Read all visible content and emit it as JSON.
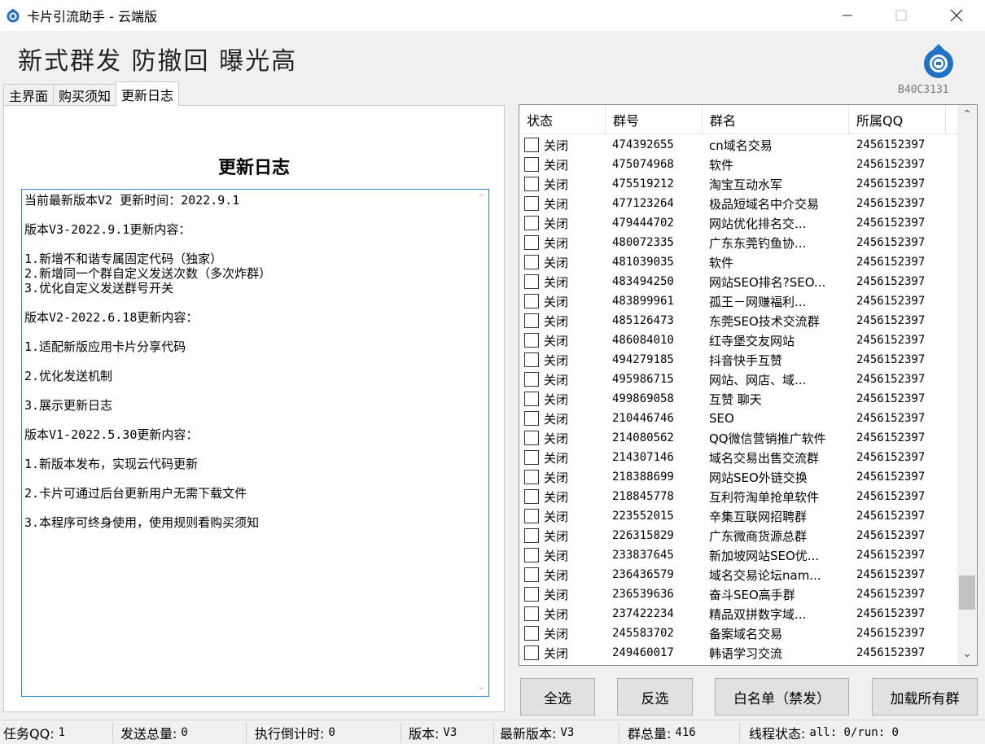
{
  "window": {
    "title": "卡片引流助手 - 云端版",
    "minimize_glyph": "—",
    "close_glyph": "✕",
    "icon": "app-logo-icon"
  },
  "header": {
    "slogan": "新式群发 防撤回 曝光高",
    "version_code": "B40C3131",
    "accent_color": "#1e73c8"
  },
  "tabs": [
    {
      "label": "主界面",
      "active": false
    },
    {
      "label": "购买须知",
      "active": false
    },
    {
      "label": "更新日志",
      "active": true
    }
  ],
  "changelog": {
    "title": "更新日志",
    "lines": [
      "当前最新版本V2 更新时间：2022.9.1",
      "",
      "版本V3-2022.9.1更新内容：",
      "",
      "1.新增不和谐专属固定代码（独家）",
      "2.新增同一个群自定义发送次数（多次炸群）",
      "3.优化自定义发送群号开关",
      "",
      "版本V2-2022.6.18更新内容：",
      "",
      "1.适配新版应用卡片分享代码",
      "",
      "2.优化发送机制",
      "",
      "3.展示更新日志",
      "",
      "版本V1-2022.5.30更新内容：",
      "",
      "1.新版本发布，实现云代码更新",
      "",
      "2.卡片可通过后台更新用户无需下载文件",
      "",
      "3.本程序可终身使用，使用规则看购买须知"
    ]
  },
  "group_list": {
    "columns": [
      "状态",
      "群号",
      "群名",
      "所属QQ"
    ],
    "rows": [
      {
        "status": "关闭",
        "id": "474392655",
        "name": "cn域名交易",
        "qq": "2456152397"
      },
      {
        "status": "关闭",
        "id": "475074968",
        "name": "软件",
        "qq": "2456152397"
      },
      {
        "status": "关闭",
        "id": "475519212",
        "name": "淘宝互动水军",
        "qq": "2456152397"
      },
      {
        "status": "关闭",
        "id": "477123264",
        "name": "极品短域名中介交易",
        "qq": "2456152397"
      },
      {
        "status": "关闭",
        "id": "479444702",
        "name": "网站优化排名交...",
        "qq": "2456152397"
      },
      {
        "status": "关闭",
        "id": "480072335",
        "name": "广东东莞钓鱼协...",
        "qq": "2456152397"
      },
      {
        "status": "关闭",
        "id": "481039035",
        "name": "软件",
        "qq": "2456152397"
      },
      {
        "status": "关闭",
        "id": "483494250",
        "name": "网站SEO排名?SEO...",
        "qq": "2456152397"
      },
      {
        "status": "关闭",
        "id": "483899961",
        "name": "孤王－网赚福利...",
        "qq": "2456152397"
      },
      {
        "status": "关闭",
        "id": "485126473",
        "name": "东莞SEO技术交流群",
        "qq": "2456152397"
      },
      {
        "status": "关闭",
        "id": "486084010",
        "name": "红寺堡交友网站",
        "qq": "2456152397"
      },
      {
        "status": "关闭",
        "id": "494279185",
        "name": "抖音快手互赞",
        "qq": "2456152397"
      },
      {
        "status": "关闭",
        "id": "495986715",
        "name": "网站、网店、域...",
        "qq": "2456152397"
      },
      {
        "status": "关闭",
        "id": "499869058",
        "name": "互赞  聊天",
        "qq": "2456152397"
      },
      {
        "status": "关闭",
        "id": "210446746",
        "name": "SEO",
        "qq": "2456152397"
      },
      {
        "status": "关闭",
        "id": "214080562",
        "name": "QQ微信营销推广软件",
        "qq": "2456152397"
      },
      {
        "status": "关闭",
        "id": "214307146",
        "name": "域名交易出售交流群",
        "qq": "2456152397"
      },
      {
        "status": "关闭",
        "id": "218388699",
        "name": "网站SEO外链交换",
        "qq": "2456152397"
      },
      {
        "status": "关闭",
        "id": "218845778",
        "name": "互利符淘单抢单软件",
        "qq": "2456152397"
      },
      {
        "status": "关闭",
        "id": "223552015",
        "name": "辛集互联网招聘群",
        "qq": "2456152397"
      },
      {
        "status": "关闭",
        "id": "226315829",
        "name": "广东微商货源总群",
        "qq": "2456152397"
      },
      {
        "status": "关闭",
        "id": "233837645",
        "name": "新加坡网站SEO优...",
        "qq": "2456152397"
      },
      {
        "status": "关闭",
        "id": "236436579",
        "name": "域名交易论坛nam...",
        "qq": "2456152397"
      },
      {
        "status": "关闭",
        "id": "236539636",
        "name": "奋斗SEO高手群",
        "qq": "2456152397"
      },
      {
        "status": "关闭",
        "id": "237422234",
        "name": "精品双拼数字域...",
        "qq": "2456152397"
      },
      {
        "status": "关闭",
        "id": "245583702",
        "name": "备案域名交易",
        "qq": "2456152397"
      },
      {
        "status": "关闭",
        "id": "249460017",
        "name": "韩语学习交流",
        "qq": "2456152397"
      }
    ],
    "scroll_position": 0.92
  },
  "buttons": {
    "select_all": "全选",
    "invert": "反选",
    "whitelist": "白名单（禁发）",
    "load_all": "加载所有群"
  },
  "statusbar": {
    "task_qq_label": "任务QQ:",
    "task_qq_value": "1",
    "total_sent_label": "发送总量:",
    "total_sent_value": "0",
    "countdown_label": "执行倒计时:",
    "countdown_value": "0",
    "version_label": "版本:",
    "version_value": "V3",
    "latest_version_label": "最新版本:",
    "latest_version_value": "V3",
    "group_total_label": "群总量:",
    "group_total_value": "416",
    "thread_label": "线程状态:",
    "thread_value": "all: 0/run: 0"
  }
}
